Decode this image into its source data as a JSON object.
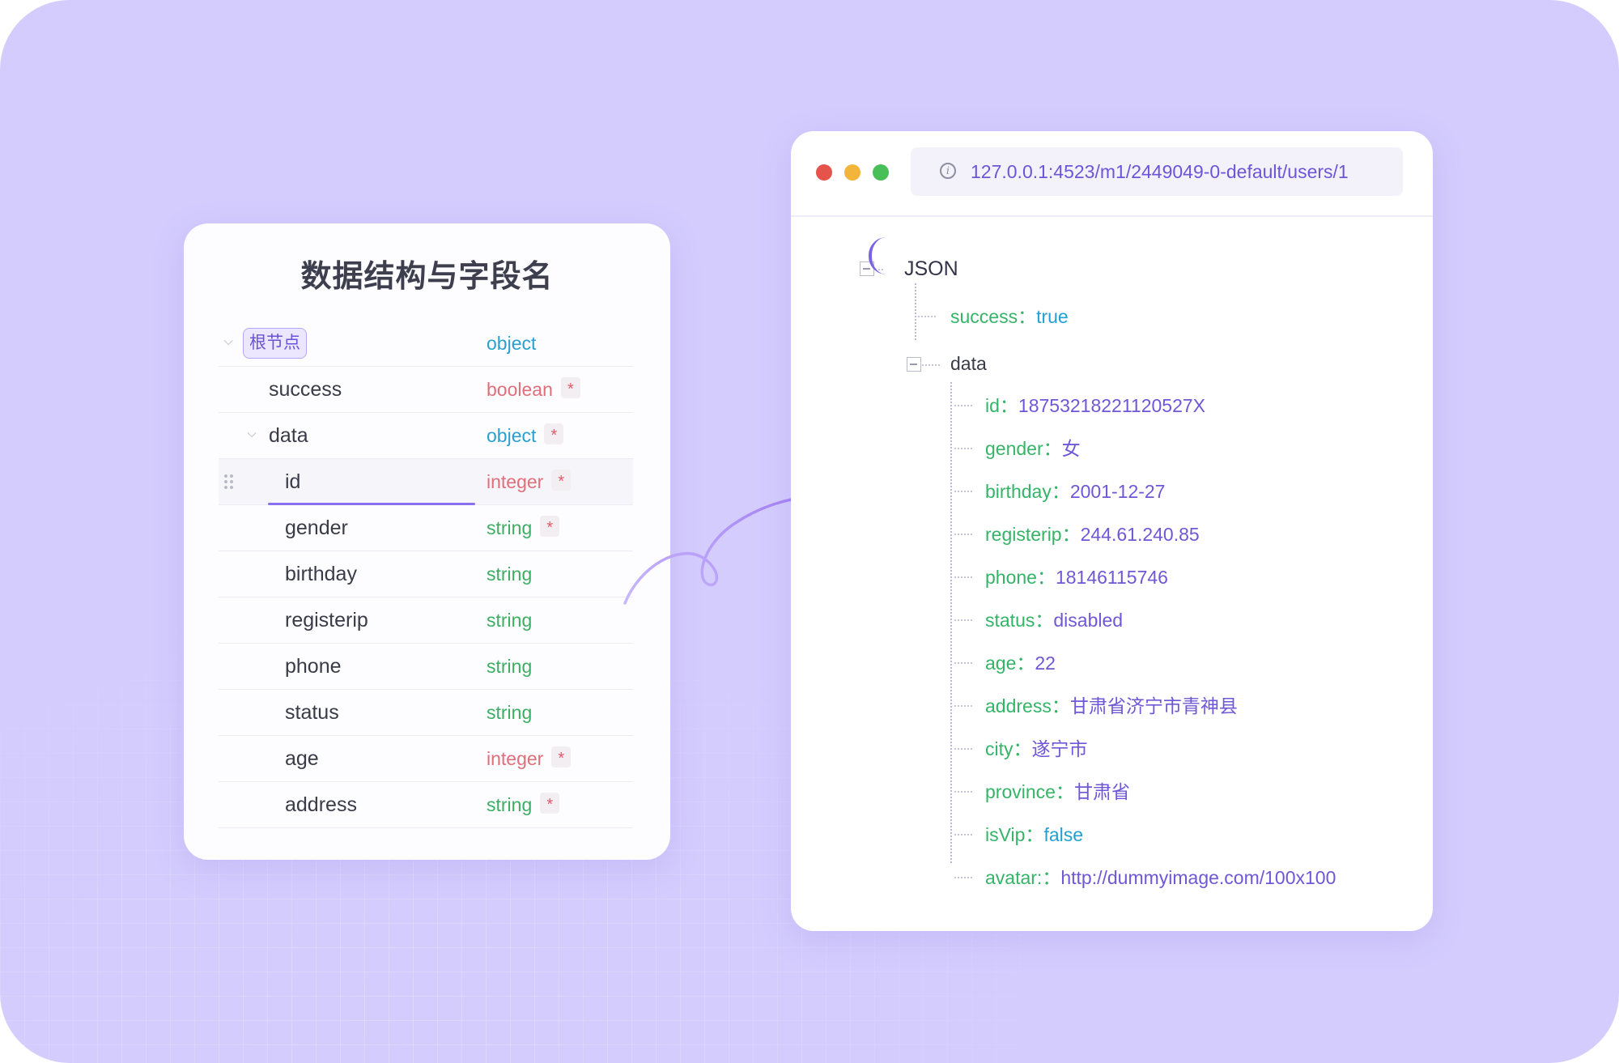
{
  "schema": {
    "title": "数据结构与字段名",
    "rows": [
      {
        "name": "根节点",
        "type": "object",
        "required": false
      },
      {
        "name": "success",
        "type": "boolean",
        "required": true
      },
      {
        "name": "data",
        "type": "object",
        "required": true
      },
      {
        "name": "id",
        "type": "integer",
        "required": true
      },
      {
        "name": "gender",
        "type": "string",
        "required": true
      },
      {
        "name": "birthday",
        "type": "string",
        "required": false
      },
      {
        "name": "registerip",
        "type": "string",
        "required": false
      },
      {
        "name": "phone",
        "type": "string",
        "required": false
      },
      {
        "name": "status",
        "type": "string",
        "required": false
      },
      {
        "name": "age",
        "type": "integer",
        "required": true
      },
      {
        "name": "address",
        "type": "string",
        "required": true
      }
    ],
    "required_mark": "*"
  },
  "browser": {
    "url": "127.0.0.1:4523/m1/2449049-0-default/users/1",
    "url_icon": "i",
    "tree": {
      "root_label": "JSON",
      "success_key": "success：",
      "success_value": "true",
      "data_key": "data",
      "fields": [
        {
          "key": "id：",
          "value": "18753218221120527X"
        },
        {
          "key": "gender：",
          "value": "女"
        },
        {
          "key": "birthday：",
          "value": "2001-12-27"
        },
        {
          "key": "registerip：",
          "value": "244.61.240.85"
        },
        {
          "key": "phone：",
          "value": "18146115746"
        },
        {
          "key": "status：",
          "value": "disabled"
        },
        {
          "key": "age：",
          "value": "22"
        },
        {
          "key": "address：",
          "value": "甘肃省济宁市青神县"
        },
        {
          "key": "city：",
          "value": "遂宁市"
        },
        {
          "key": "province：",
          "value": "甘肃省"
        },
        {
          "key": "isVip：",
          "value": "false"
        },
        {
          "key": "avatar:：",
          "value": "http://dummyimage.com/100x100"
        }
      ]
    }
  },
  "colors": {
    "background": "#d4ccfd",
    "accent": "#7b63e6",
    "key_green": "#35b468",
    "value_purple": "#7057d6",
    "required_red": "#e25a68",
    "traffic_red": "#e5534b",
    "traffic_yellow": "#f2b43a",
    "traffic_green": "#48c057"
  },
  "icons": [
    "chevron-down-icon",
    "drag-handle-icon",
    "info-icon",
    "collapse-box-icon",
    "arrow-connector-icon"
  ]
}
